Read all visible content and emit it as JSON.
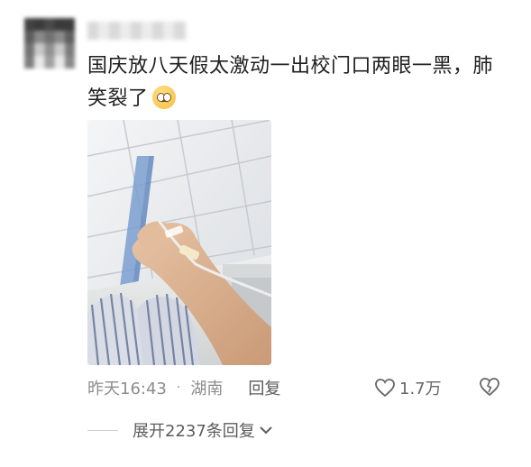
{
  "comment": {
    "text": "国庆放八天假太激动一出校门口两眼一黑，肺笑裂了",
    "emoji": "pleading-face-emoji"
  },
  "photo": {
    "subject": "arm-with-iv-drip"
  },
  "meta": {
    "time": "昨天16:43",
    "separator": "·",
    "location": "湖南",
    "reply_label": "回复",
    "likes_count": "1.7万"
  },
  "replies": {
    "expand_label": "展开2237条回复"
  },
  "icons": {
    "like": "heart-outline-icon",
    "dislike": "broken-heart-icon",
    "expand": "chevron-down-icon"
  },
  "colors": {
    "text_primary": "#202020",
    "text_secondary": "#8c8c8c"
  }
}
